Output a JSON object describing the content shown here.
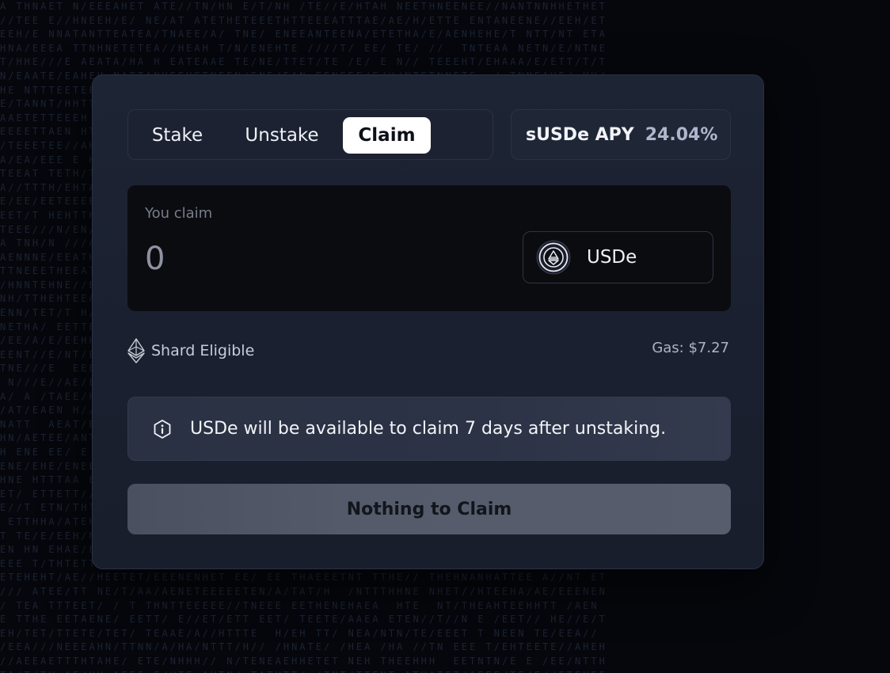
{
  "tabs": {
    "stake": "Stake",
    "unstake": "Unstake",
    "claim": "Claim",
    "active": "Claim"
  },
  "apy": {
    "label": "sUSDe APY",
    "value": "24.04%"
  },
  "claim_box": {
    "label": "You claim",
    "amount": "0",
    "token": {
      "name": "USDe",
      "icon": "usde-token-icon"
    }
  },
  "shard": {
    "icon": "ethereum-icon",
    "label": "Shard Eligible"
  },
  "gas": "Gas: $7.27",
  "notice": {
    "icon": "info-icon",
    "text": "USDe will be available to claim 7 days after unstaking."
  },
  "cta": {
    "label": "Nothing to Claim"
  },
  "colors": {
    "background": "#05070c",
    "card": "#1b2131",
    "active_tab": "#ffffff",
    "button_disabled": "#555b6b"
  }
}
